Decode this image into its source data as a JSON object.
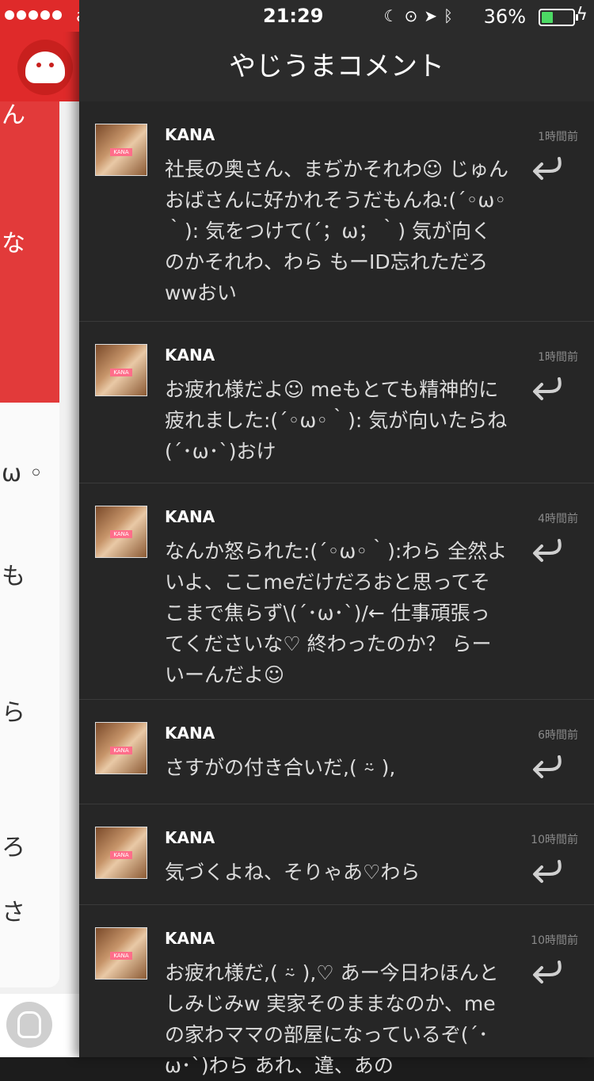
{
  "status_bar": {
    "carrier": "au",
    "time": "21:29",
    "battery": "36%"
  },
  "left_panel": {
    "peek_chars": [
      "ん",
      "な",
      "ω ◦",
      "も",
      "ら",
      "ろ",
      "さ"
    ]
  },
  "header": {
    "title": "やじうまコメント"
  },
  "comments": [
    {
      "user": "KANA",
      "time": "1時間前",
      "text": "社長の奥さん、まぢかそれわ☺ じゅんおばさんに好かれそうだもんね:(´◦ω◦｀): 気をつけて(´；ω；｀) 気が向くのかそれわ、わら もーID忘れただろwwおい"
    },
    {
      "user": "KANA",
      "time": "1時間前",
      "text": "お疲れ様だよ☺ meもとても精神的に疲れました:(´◦ω◦｀): 気が向いたらね(´･ω･`)おけ"
    },
    {
      "user": "KANA",
      "time": "4時間前",
      "text": "なんか怒られた:(´◦ω◦｀):わら 全然よいよ、ここmeだけだろおと思ってそこまで焦らず\\(´･ω･`)/← 仕事頑張ってくださいな♡ 終わったのか？ らーいーんだよ☺"
    },
    {
      "user": "KANA",
      "time": "6時間前",
      "text": "さすがの付き合いだ,( ⍨ ),"
    },
    {
      "user": "KANA",
      "time": "10時間前",
      "text": "気づくよね、そりゃあ♡わら"
    },
    {
      "user": "KANA",
      "time": "10時間前",
      "text": "お疲れ様だ,( ⍨ ),♡ あー今日わほんとしみじみw 実家そのままなのか、meの家わママの部屋になっているぞ(´･ω･`)わら あれ、違、あの"
    }
  ]
}
